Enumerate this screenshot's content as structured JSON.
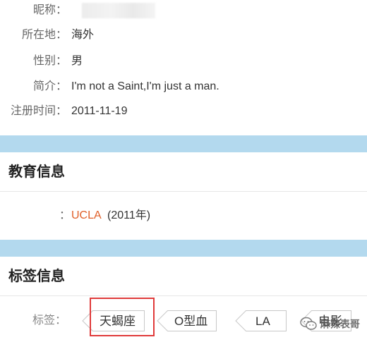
{
  "profile": {
    "nickname_label": "昵称：",
    "location_label": "所在地：",
    "location_value": "海外",
    "gender_label": "性别：",
    "gender_value": "男",
    "bio_label": "简介：",
    "bio_value": "I'm not a Saint,I'm just a man.",
    "register_label": "注册时间：",
    "register_value": "2011-11-19"
  },
  "education": {
    "title": "教育信息",
    "colon": "：",
    "school": "UCLA",
    "year": "(2011年)"
  },
  "tags": {
    "title": "标签信息",
    "label": "标签：",
    "items": [
      "天蝎座",
      "O型血",
      "LA",
      "电影"
    ]
  },
  "colors": {
    "band": "#b3d9ee",
    "link": "#e0602a",
    "highlight": "#e03a3a"
  },
  "watermark": {
    "text": "麻辣表哥",
    "icon": "wechat-icon"
  }
}
